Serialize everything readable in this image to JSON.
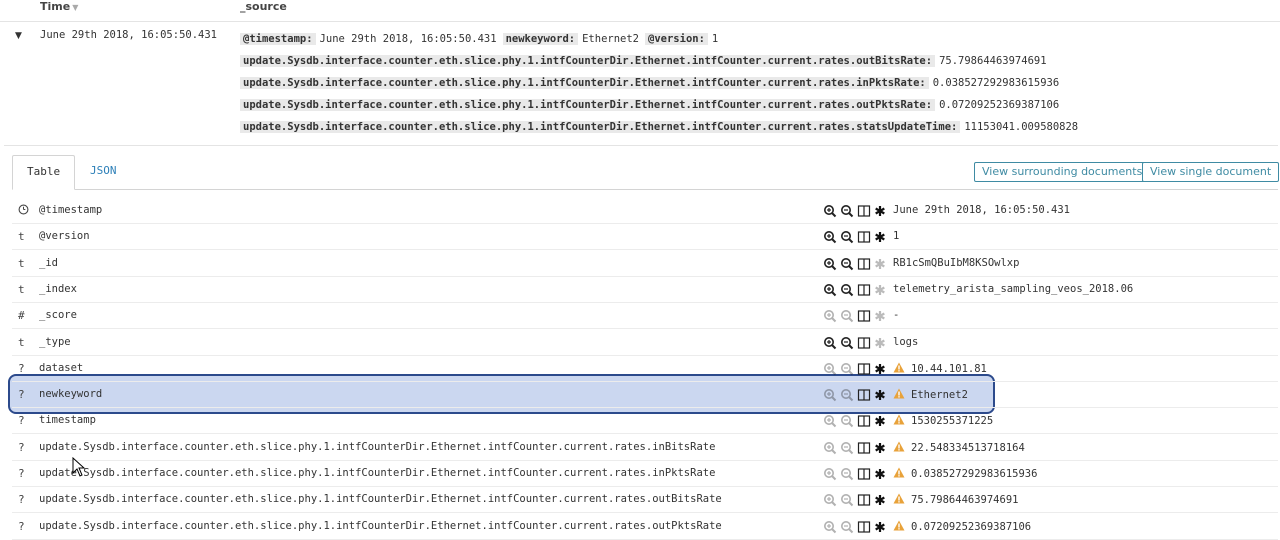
{
  "header": {
    "time": "Time",
    "source": "_source"
  },
  "document": {
    "time": "June 29th 2018, 16:05:50.431",
    "source_lines": [
      [
        {
          "key": "@timestamp:",
          "value": "June 29th 2018, 16:05:50.431"
        },
        {
          "key": "newkeyword:",
          "value": "Ethernet2"
        },
        {
          "key": "@version:",
          "value": "1"
        }
      ],
      [
        {
          "key": "update.Sysdb.interface.counter.eth.slice.phy.1.intfCounterDir.Ethernet.intfCounter.current.rates.outBitsRate:",
          "value": "75.79864463974691"
        }
      ],
      [
        {
          "key": "update.Sysdb.interface.counter.eth.slice.phy.1.intfCounterDir.Ethernet.intfCounter.current.rates.inPktsRate:",
          "value": "0.038527292983615936"
        }
      ],
      [
        {
          "key": "update.Sysdb.interface.counter.eth.slice.phy.1.intfCounterDir.Ethernet.intfCounter.current.rates.outPktsRate:",
          "value": "0.07209252369387106"
        }
      ],
      [
        {
          "key": "update.Sysdb.interface.counter.eth.slice.phy.1.intfCounterDir.Ethernet.intfCounter.current.rates.statsUpdateTime:",
          "value": "11153041.009580828"
        }
      ]
    ]
  },
  "tabs": [
    "Table",
    "JSON"
  ],
  "buttons": {
    "surrounding": "View surrounding documents",
    "single": "View single document"
  },
  "fields": [
    {
      "type": "clock",
      "name": "@timestamp",
      "value": "June 29th 2018, 16:05:50.431",
      "filterable": true,
      "existsFilter": true,
      "warning": false
    },
    {
      "type": "t",
      "name": "@version",
      "value": "1",
      "filterable": true,
      "existsFilter": true,
      "warning": false
    },
    {
      "type": "t",
      "name": "_id",
      "value": "RB1cSmQBuIbM8KSOwlxp",
      "filterable": true,
      "existsFilter": false,
      "warning": false
    },
    {
      "type": "t",
      "name": "_index",
      "value": "telemetry_arista_sampling_veos_2018.06",
      "filterable": true,
      "existsFilter": false,
      "warning": false
    },
    {
      "type": "#",
      "name": "_score",
      "value": "-",
      "filterable": false,
      "existsFilter": false,
      "warning": false
    },
    {
      "type": "t",
      "name": "_type",
      "value": "logs",
      "filterable": true,
      "existsFilter": false,
      "warning": false
    },
    {
      "type": "?",
      "name": "dataset",
      "value": "10.44.101.81",
      "filterable": false,
      "existsFilter": true,
      "warning": true
    },
    {
      "type": "?",
      "name": "newkeyword",
      "value": "Ethernet2",
      "filterable": false,
      "existsFilter": true,
      "warning": true
    },
    {
      "type": "?",
      "name": "timestamp",
      "value": "1530255371225",
      "filterable": false,
      "existsFilter": true,
      "warning": true
    },
    {
      "type": "?",
      "name": "update.Sysdb.interface.counter.eth.slice.phy.1.intfCounterDir.Ethernet.intfCounter.current.rates.inBitsRate",
      "value": "22.548334513718164",
      "filterable": false,
      "existsFilter": true,
      "warning": true
    },
    {
      "type": "?",
      "name": "update.Sysdb.interface.counter.eth.slice.phy.1.intfCounterDir.Ethernet.intfCounter.current.rates.inPktsRate",
      "value": "0.038527292983615936",
      "filterable": false,
      "existsFilter": true,
      "warning": true
    },
    {
      "type": "?",
      "name": "update.Sysdb.interface.counter.eth.slice.phy.1.intfCounterDir.Ethernet.intfCounter.current.rates.outBitsRate",
      "value": "75.79864463974691",
      "filterable": false,
      "existsFilter": true,
      "warning": true
    },
    {
      "type": "?",
      "name": "update.Sysdb.interface.counter.eth.slice.phy.1.intfCounterDir.Ethernet.intfCounter.current.rates.outPktsRate",
      "value": "0.07209252369387106",
      "filterable": false,
      "existsFilter": true,
      "warning": true
    }
  ],
  "icons": {
    "filter_for": "zoom-in-icon",
    "filter_out": "zoom-out-icon",
    "toggle_column": "toggle-column-icon",
    "exists": "asterisk-icon",
    "warning": "warning-icon",
    "time_type": "clock-icon"
  },
  "colors": {
    "link": "#2c7fb8",
    "button": "#3f8ba3",
    "warning": "#e8a23a",
    "highlight": "#a0b7e4",
    "highlight_border": "#2c4a8c"
  }
}
